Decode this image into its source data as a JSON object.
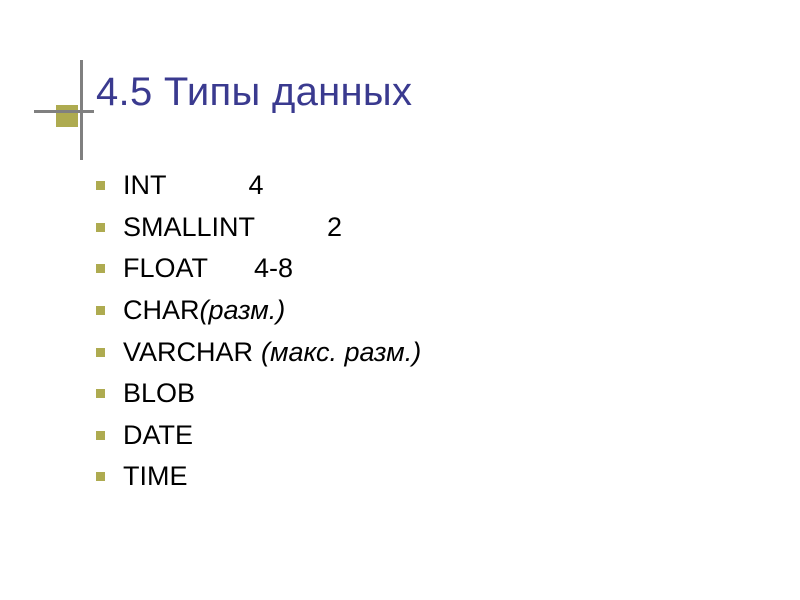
{
  "title": "4.5 Типы данных",
  "items": [
    {
      "name": "INT",
      "value": "4",
      "spacer": "sp1",
      "italicVal": false,
      "attachedItalic": ""
    },
    {
      "name": "SMALLINT",
      "value": "2",
      "spacer": "sp2",
      "italicVal": false,
      "attachedItalic": ""
    },
    {
      "name": "FLOAT",
      "value": "4-8",
      "spacer": "sp3",
      "italicVal": false,
      "attachedItalic": ""
    },
    {
      "name": "CHAR",
      "value": "",
      "spacer": "",
      "italicVal": false,
      "attachedItalic": "(разм.)"
    },
    {
      "name": "VARCHAR",
      "value": "(макс. разм.)",
      "spacer": "sp4",
      "italicVal": true,
      "attachedItalic": ""
    },
    {
      "name": "BLOB",
      "value": "",
      "spacer": "",
      "italicVal": false,
      "attachedItalic": ""
    },
    {
      "name": "DATE",
      "value": "",
      "spacer": "",
      "italicVal": false,
      "attachedItalic": ""
    },
    {
      "name": "TIME",
      "value": "",
      "spacer": "",
      "italicVal": false,
      "attachedItalic": ""
    }
  ]
}
